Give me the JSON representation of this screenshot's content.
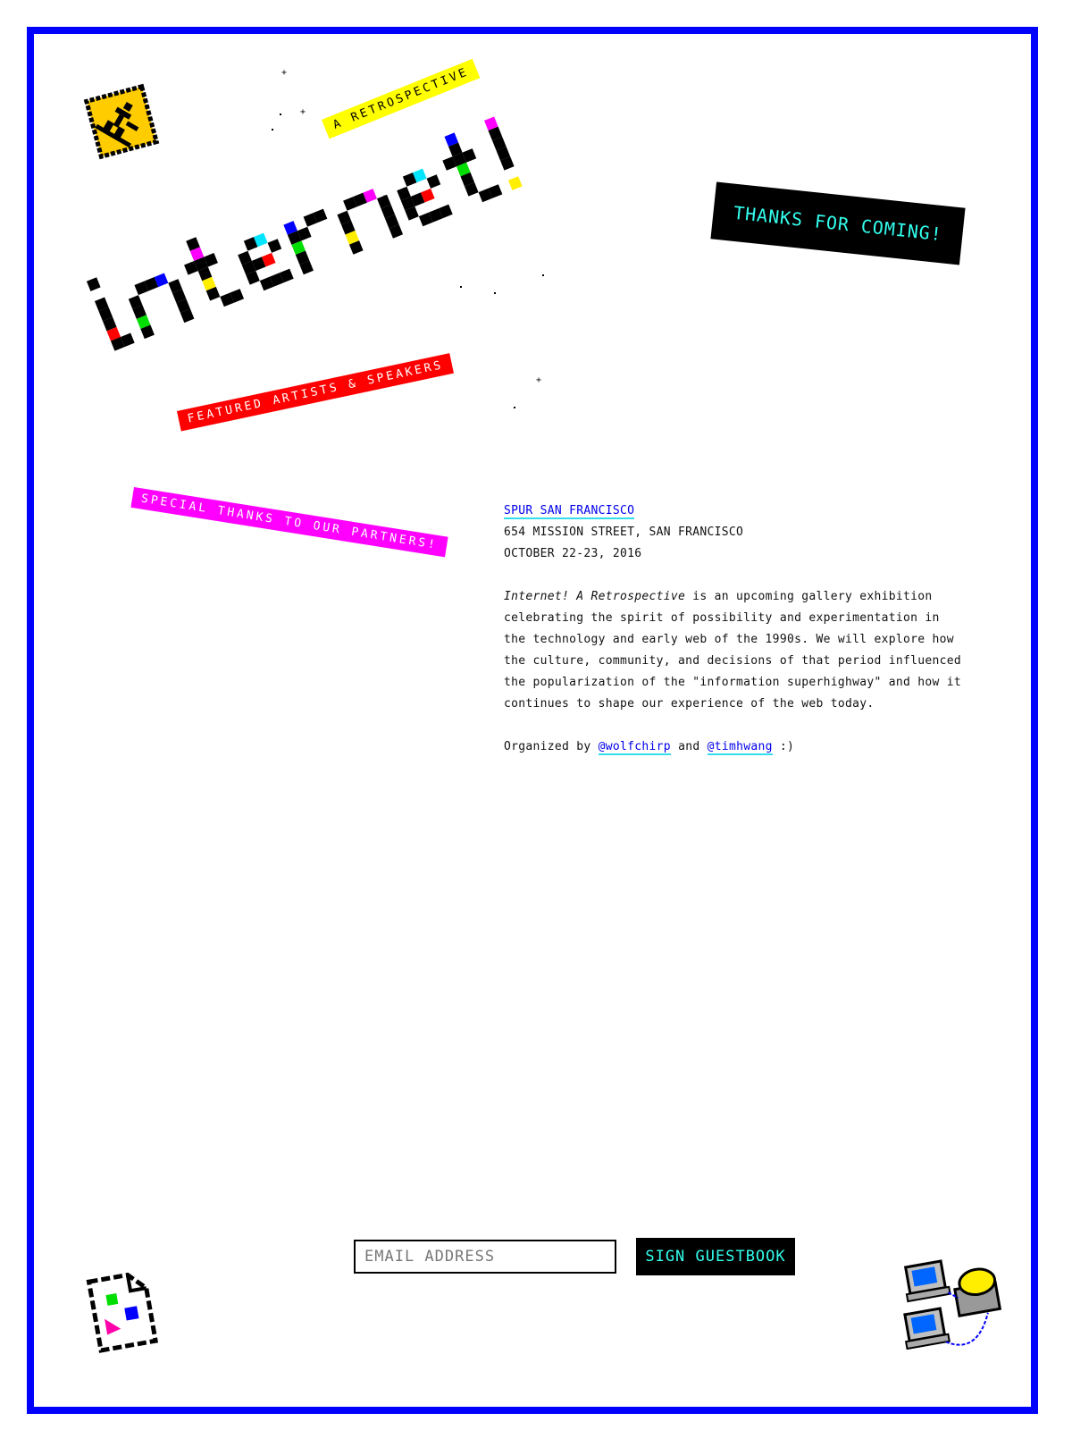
{
  "header": {
    "title_graphic": "internet!",
    "subtitle_tag": "A RETROSPECTIVE",
    "thanks_sticker": "THANKS FOR COMING!"
  },
  "tags": {
    "featured": "FEATURED ARTISTS & SPEAKERS",
    "partners": "SPECIAL THANKS TO OUR PARTNERS!"
  },
  "venue": {
    "name": "SPUR SAN FRANCISCO",
    "address": "654 MISSION STREET, SAN FRANCISCO",
    "dates": "OCTOBER 22-23, 2016"
  },
  "description": {
    "italic_title": "Internet! A Retrospective",
    "body": " is an upcoming gallery exhibition celebrating the spirit of possibility and experimentation in the technology and early web of the 1990s. We will explore how the culture, community, and decisions of that period influenced the popularization of the \"information superhighway\" and how it continues to shape our experience of the web today."
  },
  "organizers": {
    "prefix": "Organized by ",
    "org1": "@wolfchirp",
    "joiner": " and ",
    "org2": "@timhwang",
    "suffix": " :)"
  },
  "guestbook": {
    "placeholder": "EMAIL ADDRESS",
    "button_label": "SIGN GUESTBOOK"
  },
  "icons": {
    "warning_sign": "construction-sign-icon",
    "document": "broken-document-icon",
    "network": "network-computers-icon"
  },
  "colors": {
    "frame": "#0000ff",
    "cyan": "#33ffee",
    "yellow": "#ffff00",
    "red": "#ff0000",
    "magenta": "#ff00ff"
  }
}
